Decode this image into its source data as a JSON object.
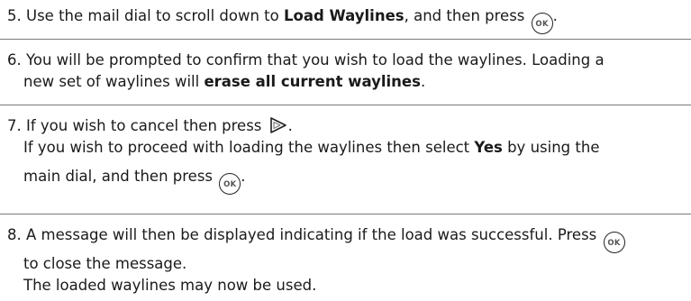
{
  "steps": [
    {
      "number": "5.",
      "lines": [
        {
          "pre": "Use the mail dial to scroll down to ",
          "bold": "Load Waylines",
          "post": ", and then press",
          "tail": "."
        }
      ]
    },
    {
      "number": "6.",
      "line1": "You will be prompted to confirm that you wish to load the waylines. Loading a",
      "line2_pre": "new set of waylines will ",
      "line2_bold": "erase all current waylines",
      "line2_post": "."
    },
    {
      "number": "7.",
      "line1_pre": "If you wish to cancel then press",
      "line1_post": ".",
      "line2_pre": "If you wish to proceed with loading the waylines then select ",
      "line2_bold": "Yes",
      "line2_post": " by using the",
      "line3_pre": "main dial, and then press",
      "line3_post": "."
    },
    {
      "number": "8.",
      "line1_pre": "A message will then be displayed indicating if the load was successful. Press",
      "line2": "to close the message.",
      "line3": "The loaded waylines may now be used."
    }
  ],
  "icons": {
    "ok_label": "OK"
  }
}
